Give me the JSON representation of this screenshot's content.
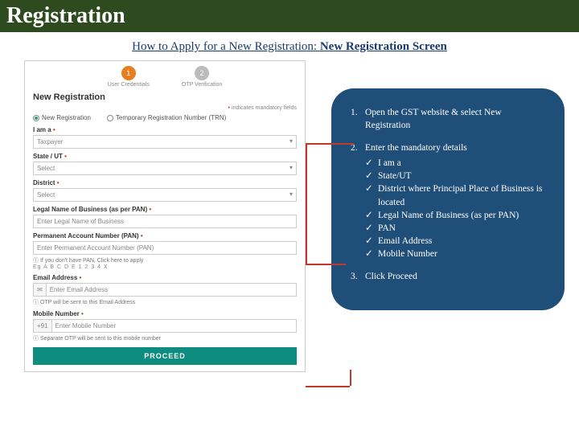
{
  "header": {
    "title": "Registration"
  },
  "subtitle": {
    "part1": "How to Apply for a New Registration: ",
    "part2": "New Registration Screen"
  },
  "form": {
    "step1_label": "User Credentials",
    "step2_label": "OTP Verification",
    "heading": "New Registration",
    "mandatory_prefix": "•",
    "mandatory_text": " indicates mandatory fields",
    "radio_new": "New Registration",
    "radio_trn": "Temporary Registration Number (TRN)",
    "iam_label": "I am a",
    "iam_value": "Taxpayer",
    "state_label": "State / UT",
    "state_value": "Select",
    "district_label": "District",
    "district_value": "Select",
    "legal_label": "Legal Name of Business (as per PAN)",
    "legal_ph": "Enter Legal Name of Business",
    "pan_label": "Permanent Account Number (PAN)",
    "pan_ph": "Enter Permanent Account Number (PAN)",
    "pan_help": "If you don't have PAN, Click here to apply",
    "pan_sample": "Eg A B C D E 1 2 3 4 X",
    "email_label": "Email Address",
    "email_ph": "Enter Email Address",
    "email_help": "OTP will be sent to this Email Address",
    "mobile_label": "Mobile Number",
    "mobile_prefix": "+91",
    "mobile_ph": "Enter Mobile Number",
    "mobile_help": "Separate OTP will be sent to this mobile number",
    "proceed": "PROCEED"
  },
  "callout": {
    "s1": "Open the GST website & select New Registration",
    "s2": "Enter the mandatory details",
    "c1": "I am a",
    "c2": "State/UT",
    "c3": "District where Principal Place of Business is located",
    "c4": "Legal Name of Business (as per PAN)",
    "c5": "PAN",
    "c6": "Email Address",
    "c7": "Mobile Number",
    "s3": "Click Proceed"
  }
}
